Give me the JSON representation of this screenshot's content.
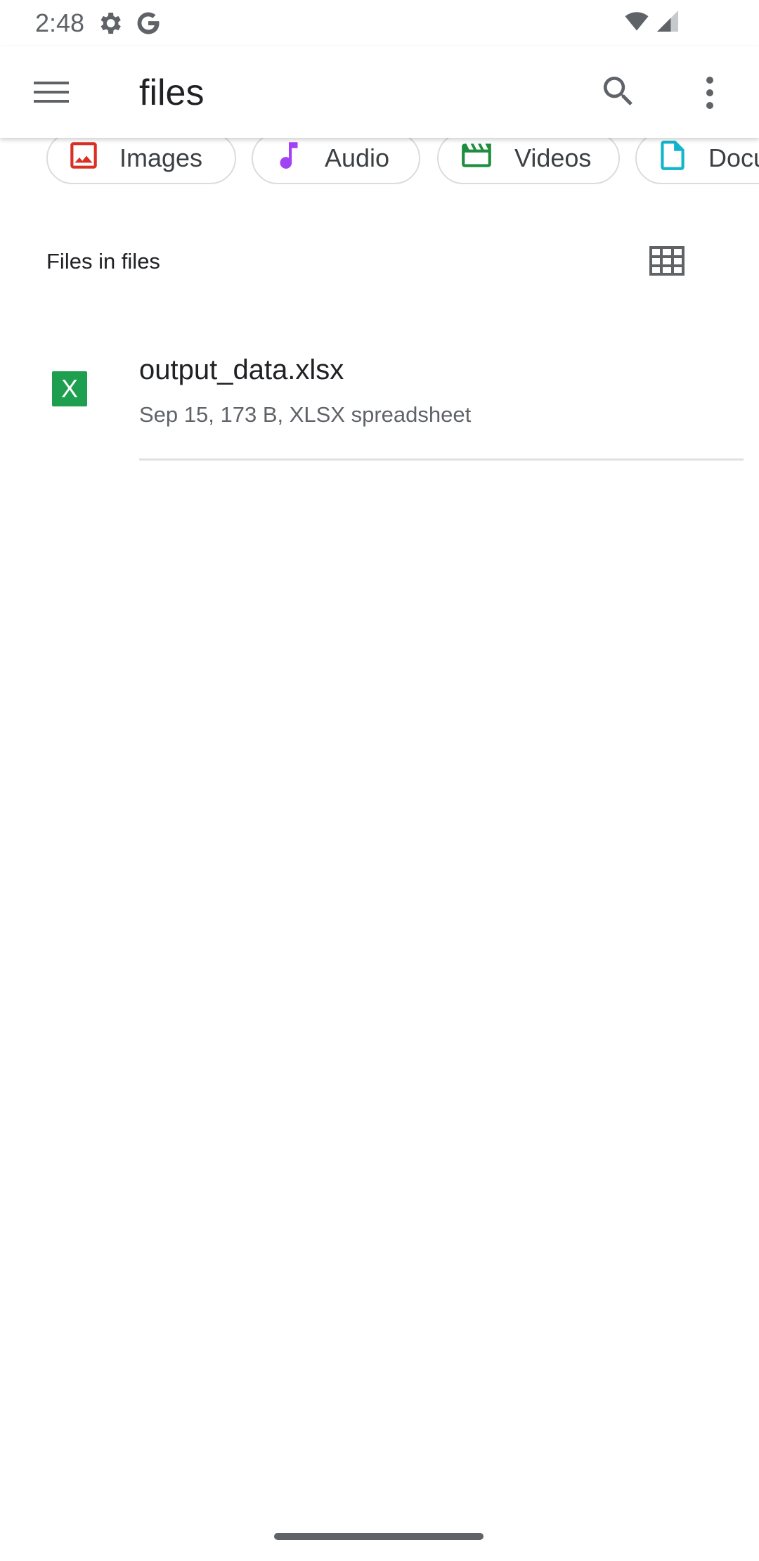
{
  "status_bar": {
    "time": "2:48",
    "icons": [
      "settings-gear-icon",
      "google-g-icon",
      "wifi-icon",
      "signal-icon"
    ]
  },
  "app_bar": {
    "title": "files",
    "icons": [
      "menu-icon",
      "search-icon",
      "more-vert-icon"
    ]
  },
  "categories": [
    {
      "label": "Images",
      "icon": "image-icon",
      "color": "#d93025"
    },
    {
      "label": "Audio",
      "icon": "music-note-icon",
      "color": "#a142f4"
    },
    {
      "label": "Videos",
      "icon": "movie-icon",
      "color": "#1e8e3e"
    },
    {
      "label": "Documents",
      "icon": "document-icon",
      "color": "#12b5cb"
    }
  ],
  "section": {
    "title": "Files in files",
    "view_toggle_icon": "grid-view-icon"
  },
  "files": [
    {
      "name": "output_data.xlsx",
      "meta": "Sep 15, 173 B, XLSX spreadsheet",
      "icon_letter": "X",
      "icon_color": "#1e9e4f"
    }
  ]
}
